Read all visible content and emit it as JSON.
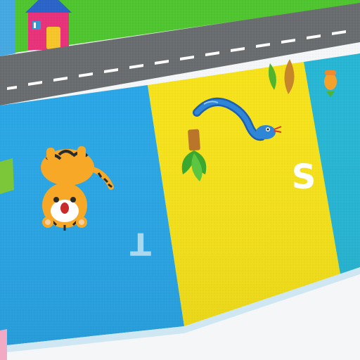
{
  "scene": {
    "subject": "play-mat",
    "letters": [
      {
        "char": "T",
        "color": "#a9d8ef"
      },
      {
        "char": "S",
        "color": "#ffffff"
      }
    ],
    "colors": {
      "grass": "#4fc52f",
      "road": "#6a6d70",
      "road_dash": "#ffffff",
      "blue_panel": "#29a6e6",
      "yellow_panel": "#f6e21a",
      "teal_panel": "#26b6d4",
      "backdrop": "#f4f6f8"
    },
    "icons": [
      "house-icon",
      "tiger-icon",
      "snake-icon",
      "pineapple-icon",
      "leaf-icon",
      "acorn-icon"
    ]
  }
}
